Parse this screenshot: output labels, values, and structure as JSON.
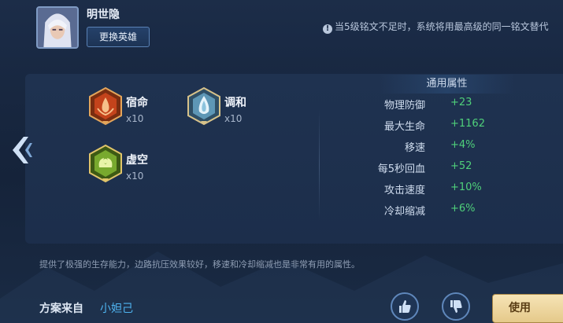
{
  "header": {
    "hero_name": "明世隐",
    "change_hero_label": "更换英雄",
    "notice_text": "当5级铭文不足时，系统将用最高级的同一铭文替代"
  },
  "runes": [
    {
      "name": "宿命",
      "count": "x10",
      "icon": "red-hexagon-rune-icon",
      "color": "#d2542a"
    },
    {
      "name": "调和",
      "count": "x10",
      "icon": "blue-hexagon-rune-icon",
      "color": "#6fa9c8"
    },
    {
      "name": "虚空",
      "count": "x10",
      "icon": "green-hexagon-rune-icon",
      "color": "#7fb035"
    }
  ],
  "stats": {
    "title": "通用属性",
    "rows": [
      {
        "label": "物理防御",
        "value": "+23"
      },
      {
        "label": "最大生命",
        "value": "+1162"
      },
      {
        "label": "移速",
        "value": "+4%"
      },
      {
        "label": "每5秒回血",
        "value": "+52"
      },
      {
        "label": "攻击速度",
        "value": "+10%"
      },
      {
        "label": "冷却缩减",
        "value": "+6%"
      }
    ]
  },
  "description": "提供了极强的生存能力，边路抗压效果较好，移速和冷却缩减也是非常有用的属性。",
  "footer": {
    "source_label": "方案来自",
    "source_author": "小妲己",
    "use_label": "使用"
  },
  "colors": {
    "stat_value": "#4fd07a",
    "accent_blue": "#4fb3f0",
    "use_button": "#f0dca8"
  }
}
